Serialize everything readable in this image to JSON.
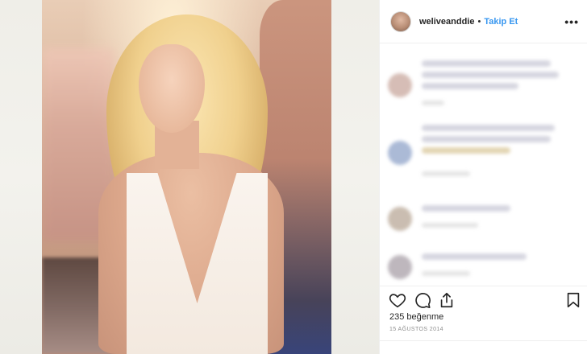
{
  "post": {
    "username": "weliveanddie",
    "separator": "•",
    "follow_label": "Takip Et",
    "more_label": "•••",
    "likes_text": "235 beğenme",
    "date_text": "15 AĞUSTOS 2014"
  },
  "icons": {
    "like": "heart-icon",
    "comment": "comment-icon",
    "share": "share-icon",
    "save": "bookmark-icon"
  },
  "colors": {
    "follow": "#3897f0",
    "text": "#262626",
    "muted": "#8e8e8e",
    "border": "#efefef"
  }
}
